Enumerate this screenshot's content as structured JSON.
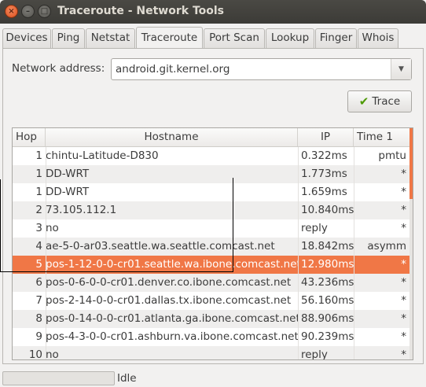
{
  "window": {
    "title": "Traceroute - Network Tools",
    "close": "×",
    "minimize": "–",
    "maximize": "□"
  },
  "tabs": [
    {
      "label": "Devices"
    },
    {
      "label": "Ping"
    },
    {
      "label": "Netstat"
    },
    {
      "label": "Traceroute"
    },
    {
      "label": "Port Scan"
    },
    {
      "label": "Lookup"
    },
    {
      "label": "Finger"
    },
    {
      "label": "Whois"
    }
  ],
  "active_tab": "Traceroute",
  "address": {
    "label": "Network address:",
    "value": "android.git.kernel.org",
    "arrow": "▼"
  },
  "trace_button": {
    "label": "Trace",
    "icon": "check-icon",
    "icon_glyph": "✔"
  },
  "table": {
    "columns": [
      "Hop",
      "Hostname",
      "IP",
      "Time 1"
    ],
    "rows": [
      {
        "hop": "1",
        "host": "chintu-Latitude-D830",
        "ip": "0.322ms",
        "t1": "pmtu"
      },
      {
        "hop": "1",
        "host": "DD-WRT",
        "ip": "1.773ms",
        "t1": "*"
      },
      {
        "hop": "1",
        "host": "DD-WRT",
        "ip": "1.659ms",
        "t1": "*"
      },
      {
        "hop": "2",
        "host": "73.105.112.1",
        "ip": "10.840ms",
        "t1": "*"
      },
      {
        "hop": "3",
        "host": "no",
        "ip": "reply",
        "t1": "*"
      },
      {
        "hop": "4",
        "host": "ae-5-0-ar03.seattle.wa.seattle.comcast.net",
        "ip": "18.842ms",
        "t1": "asymm"
      },
      {
        "hop": "5",
        "host": "pos-1-12-0-0-cr01.seattle.wa.ibone.comcast.net",
        "ip": "12.980ms",
        "t1": "*"
      },
      {
        "hop": "6",
        "host": "pos-0-6-0-0-cr01.denver.co.ibone.comcast.net",
        "ip": "43.236ms",
        "t1": "*"
      },
      {
        "hop": "7",
        "host": "pos-2-14-0-0-cr01.dallas.tx.ibone.comcast.net",
        "ip": "56.160ms",
        "t1": "*"
      },
      {
        "hop": "8",
        "host": "pos-0-14-0-0-cr01.atlanta.ga.ibone.comcast.net",
        "ip": "88.906ms",
        "t1": "*"
      },
      {
        "hop": "9",
        "host": "pos-4-3-0-0-cr01.ashburn.va.ibone.comcast.net",
        "ip": "90.239ms",
        "t1": "*"
      },
      {
        "hop": "10",
        "host": "no",
        "ip": "reply",
        "t1": "*"
      }
    ],
    "selected_row_hop": "5"
  },
  "status": {
    "text": "Idle"
  },
  "colors": {
    "accent": "#f07746",
    "titlebar": "#3c3b37",
    "window_bg": "#f2f1f0"
  }
}
